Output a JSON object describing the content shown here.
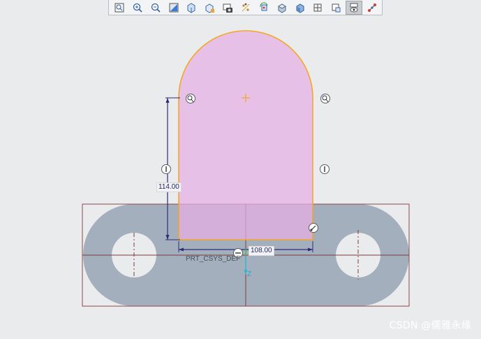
{
  "toolbar": {
    "buttons": [
      {
        "icon": "zoom-fit-icon",
        "active": false
      },
      {
        "icon": "zoom-in-icon",
        "active": false
      },
      {
        "icon": "zoom-out-icon",
        "active": false
      },
      {
        "icon": "repaint-icon",
        "active": false
      },
      {
        "icon": "saved-orientation-icon",
        "active": false
      },
      {
        "icon": "view-manager-icon",
        "active": false
      },
      {
        "icon": "screenshot-icon",
        "active": false
      },
      {
        "icon": "datum-display-icon",
        "active": false
      },
      {
        "icon": "spin-center-icon",
        "active": false
      },
      {
        "icon": "display-style-icon",
        "active": false
      },
      {
        "icon": "shaded-view-icon",
        "active": false
      },
      {
        "icon": "annotation-display-icon",
        "active": false
      },
      {
        "icon": "sketch-view-icon",
        "active": false
      },
      {
        "icon": "sketch-display-filter-icon",
        "active": true
      },
      {
        "icon": "constraint-display-icon",
        "active": false
      }
    ]
  },
  "dimensions": {
    "height_value": "114.00",
    "width_value": "108.00"
  },
  "csys": {
    "name": "PRT_CSYS_DEF",
    "axis_z": "Z"
  },
  "watermark": "CSDN @儒雅永缘",
  "colors": {
    "background": "#e9ebed",
    "base_plate": "#a3afbc",
    "sketch_fill": "#e6aee6",
    "sketch_edge": "#f5a623",
    "bounding_box": "#8a4a4a",
    "dimension": "#2c2b78"
  }
}
